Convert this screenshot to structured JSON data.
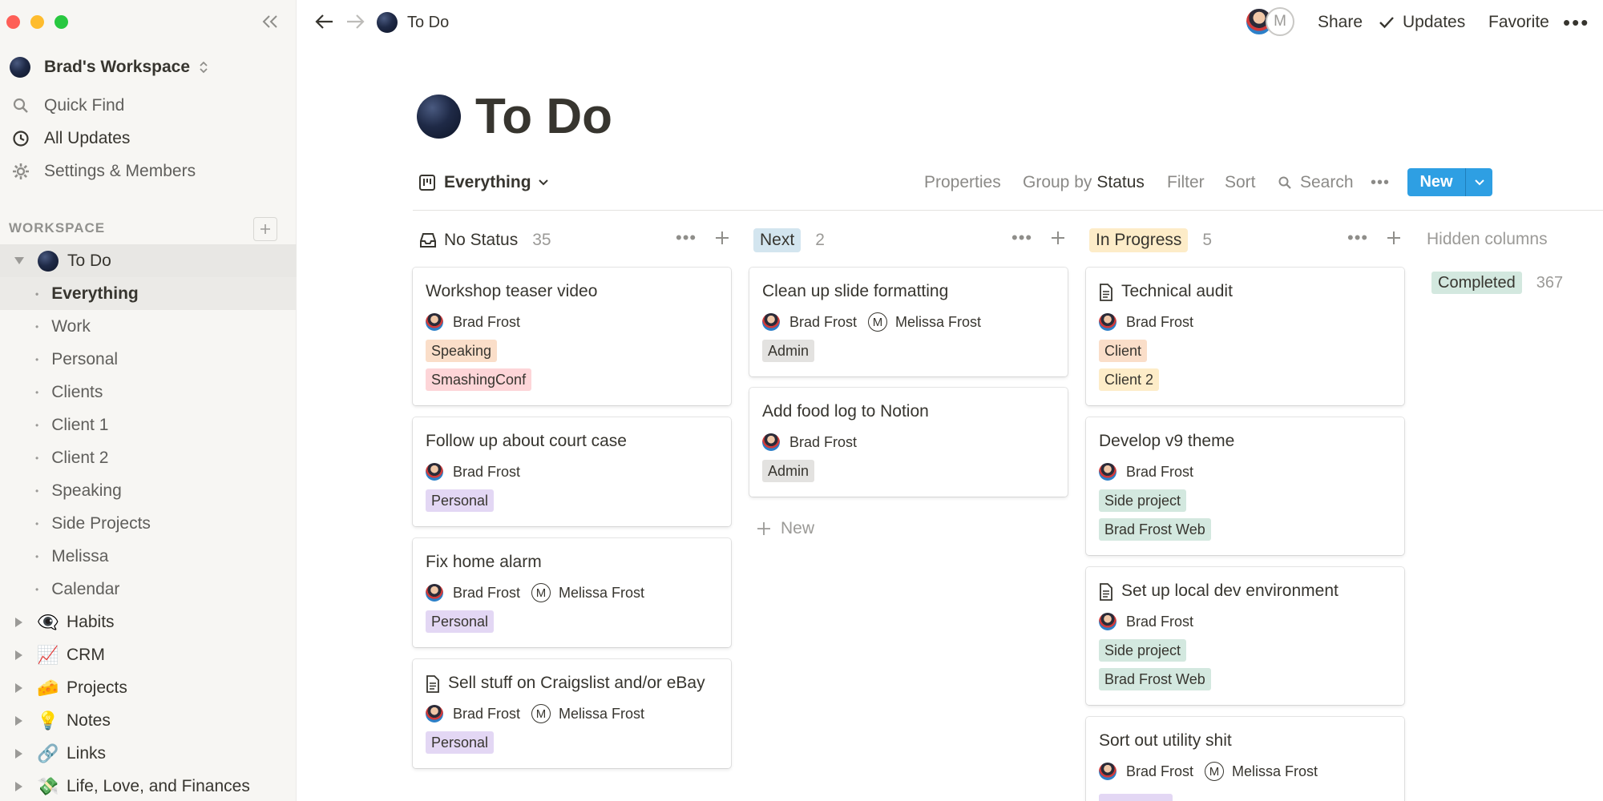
{
  "window": {
    "title": "To Do"
  },
  "sidebar": {
    "workspace_name": "Brad's Workspace",
    "nav": [
      {
        "label": "Quick Find",
        "icon": "search-icon"
      },
      {
        "label": "All Updates",
        "icon": "clock-icon"
      },
      {
        "label": "Settings & Members",
        "icon": "gear-icon"
      }
    ],
    "section_label": "WORKSPACE",
    "tree": {
      "todo": "To Do",
      "children": [
        "Everything",
        "Work",
        "Personal",
        "Clients",
        "Client 1",
        "Client 2",
        "Speaking",
        "Side Projects",
        "Melissa",
        "Calendar"
      ],
      "pages": [
        {
          "emoji": "👁️‍🗨️",
          "label": "Habits"
        },
        {
          "emoji": "📈",
          "label": "CRM"
        },
        {
          "emoji": "🧀",
          "label": "Projects"
        },
        {
          "emoji": "💡",
          "label": "Notes"
        },
        {
          "emoji": "🔗",
          "label": "Links"
        },
        {
          "emoji": "💸",
          "label": "Life, Love, and Finances"
        }
      ]
    }
  },
  "topbar": {
    "breadcrumb": "To Do",
    "avatar_m": "M",
    "share": "Share",
    "updates": "Updates",
    "favorite": "Favorite",
    "more": "•••"
  },
  "page": {
    "title": "To Do"
  },
  "view": {
    "name": "Everything",
    "properties": "Properties",
    "group_by_label": "Group by",
    "group_by_value": "Status",
    "filter": "Filter",
    "sort": "Sort",
    "search": "Search",
    "more": "•••",
    "new_label": "New"
  },
  "board": {
    "columns": [
      {
        "title": "No Status",
        "count": "35",
        "color": "#ffffff"
      },
      {
        "title": "Next",
        "count": "2",
        "color": "#d3e5ef"
      },
      {
        "title": "In Progress",
        "count": "5",
        "color": "#fdecc8"
      }
    ],
    "cards": {
      "c1": {
        "title": "Workshop teaser video",
        "person1": "Brad Frost",
        "tags": [
          "Speaking",
          "SmashingConf"
        ]
      },
      "c2": {
        "title": "Follow up about court case",
        "person1": "Brad Frost",
        "tags": [
          "Personal"
        ]
      },
      "c3": {
        "title": "Fix home alarm",
        "person1": "Brad Frost",
        "person2": "Melissa Frost",
        "tags": [
          "Personal"
        ]
      },
      "c4": {
        "title": "Sell stuff on Craigslist and/or eBay",
        "person1": "Brad Frost",
        "person2": "Melissa Frost",
        "tags": [
          "Personal"
        ]
      },
      "n1": {
        "title": "Clean up slide formatting",
        "person1": "Brad Frost",
        "person2": "Melissa Frost",
        "tags": [
          "Admin"
        ]
      },
      "n2": {
        "title": "Add food log to Notion",
        "person1": "Brad Frost",
        "tags": [
          "Admin"
        ]
      },
      "p1": {
        "title": "Technical audit",
        "person1": "Brad Frost",
        "tags": [
          "Client",
          "Client 2"
        ]
      },
      "p2": {
        "title": "Develop v9 theme",
        "person1": "Brad Frost",
        "tags": [
          "Side project",
          "Brad Frost Web"
        ]
      },
      "p3": {
        "title": "Set up local dev environment",
        "person1": "Brad Frost",
        "tags": [
          "Side project",
          "Brad Frost Web"
        ]
      },
      "p4": {
        "title": "Sort out utility shit",
        "person1": "Brad Frost",
        "person2": "Melissa Frost"
      }
    },
    "new_in_column": "New",
    "m_initial": "M",
    "hidden": {
      "title": "Hidden columns",
      "label": "Completed",
      "count": "367"
    }
  },
  "colors": {
    "accent": "#2e9fe3",
    "tag_orange": "#fadec9",
    "tag_red": "#fdd5d8",
    "tag_purple": "#e3d7f4",
    "tag_gray": "#e3e2e0",
    "tag_yellow": "#fdecc8",
    "tag_green": "#d3e8df"
  }
}
